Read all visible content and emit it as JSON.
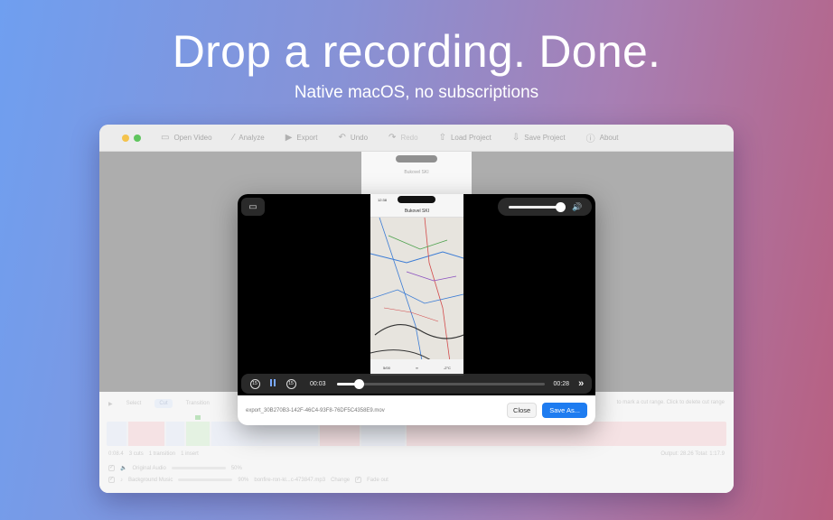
{
  "hero": {
    "title": "Drop a recording. Done.",
    "subtitle": "Native macOS, no subscriptions"
  },
  "toolbar": {
    "items": [
      {
        "label": "Open Video",
        "icon": "folder-icon"
      },
      {
        "label": "Analyze",
        "icon": "wand-icon"
      },
      {
        "label": "Export",
        "icon": "play-icon"
      },
      {
        "label": "Undo",
        "icon": "undo-icon"
      },
      {
        "label": "Redo",
        "icon": "redo-icon"
      },
      {
        "label": "Load Project",
        "icon": "upload-icon"
      },
      {
        "label": "Save Project",
        "icon": "download-icon"
      },
      {
        "label": "About",
        "icon": "info-icon"
      }
    ]
  },
  "background_phone": {
    "title": "Bukovel SKI"
  },
  "bottom_panel": {
    "modes": [
      "Select",
      "Cut",
      "Transition"
    ],
    "hint": "to mark a cut range. Click to delete cut range",
    "stats": [
      "0:08.4",
      "3 cuts",
      "1 transition",
      "1 insert"
    ],
    "output": "Output: 28.26",
    "output_extra": "Total: 1:17.9",
    "audio": [
      {
        "label": "Original Audio",
        "value": "50%"
      },
      {
        "label": "Background Music",
        "value": "90%",
        "file": "bonfire-ron-kl...c-473847.mp3",
        "change": "Change",
        "fade": "Fade out"
      }
    ]
  },
  "modal": {
    "player": {
      "time_current": "00:03",
      "time_total": "00:28",
      "progress": 0.107,
      "volume": 1.0,
      "phone_time": "12:38",
      "phone_title": "Bukovel SKI",
      "phone_stat_left": "5/00",
      "phone_stat_right": "-2°C"
    },
    "filename": "export_30B270B3-142F-46C4-93F8-76DF5C4358E9.mov",
    "close_label": "Close",
    "save_label": "Save As..."
  },
  "colors": {
    "accent": "#1e7cf0",
    "traffic_yellow": "#f4c34d",
    "traffic_green": "#5fc55e"
  }
}
